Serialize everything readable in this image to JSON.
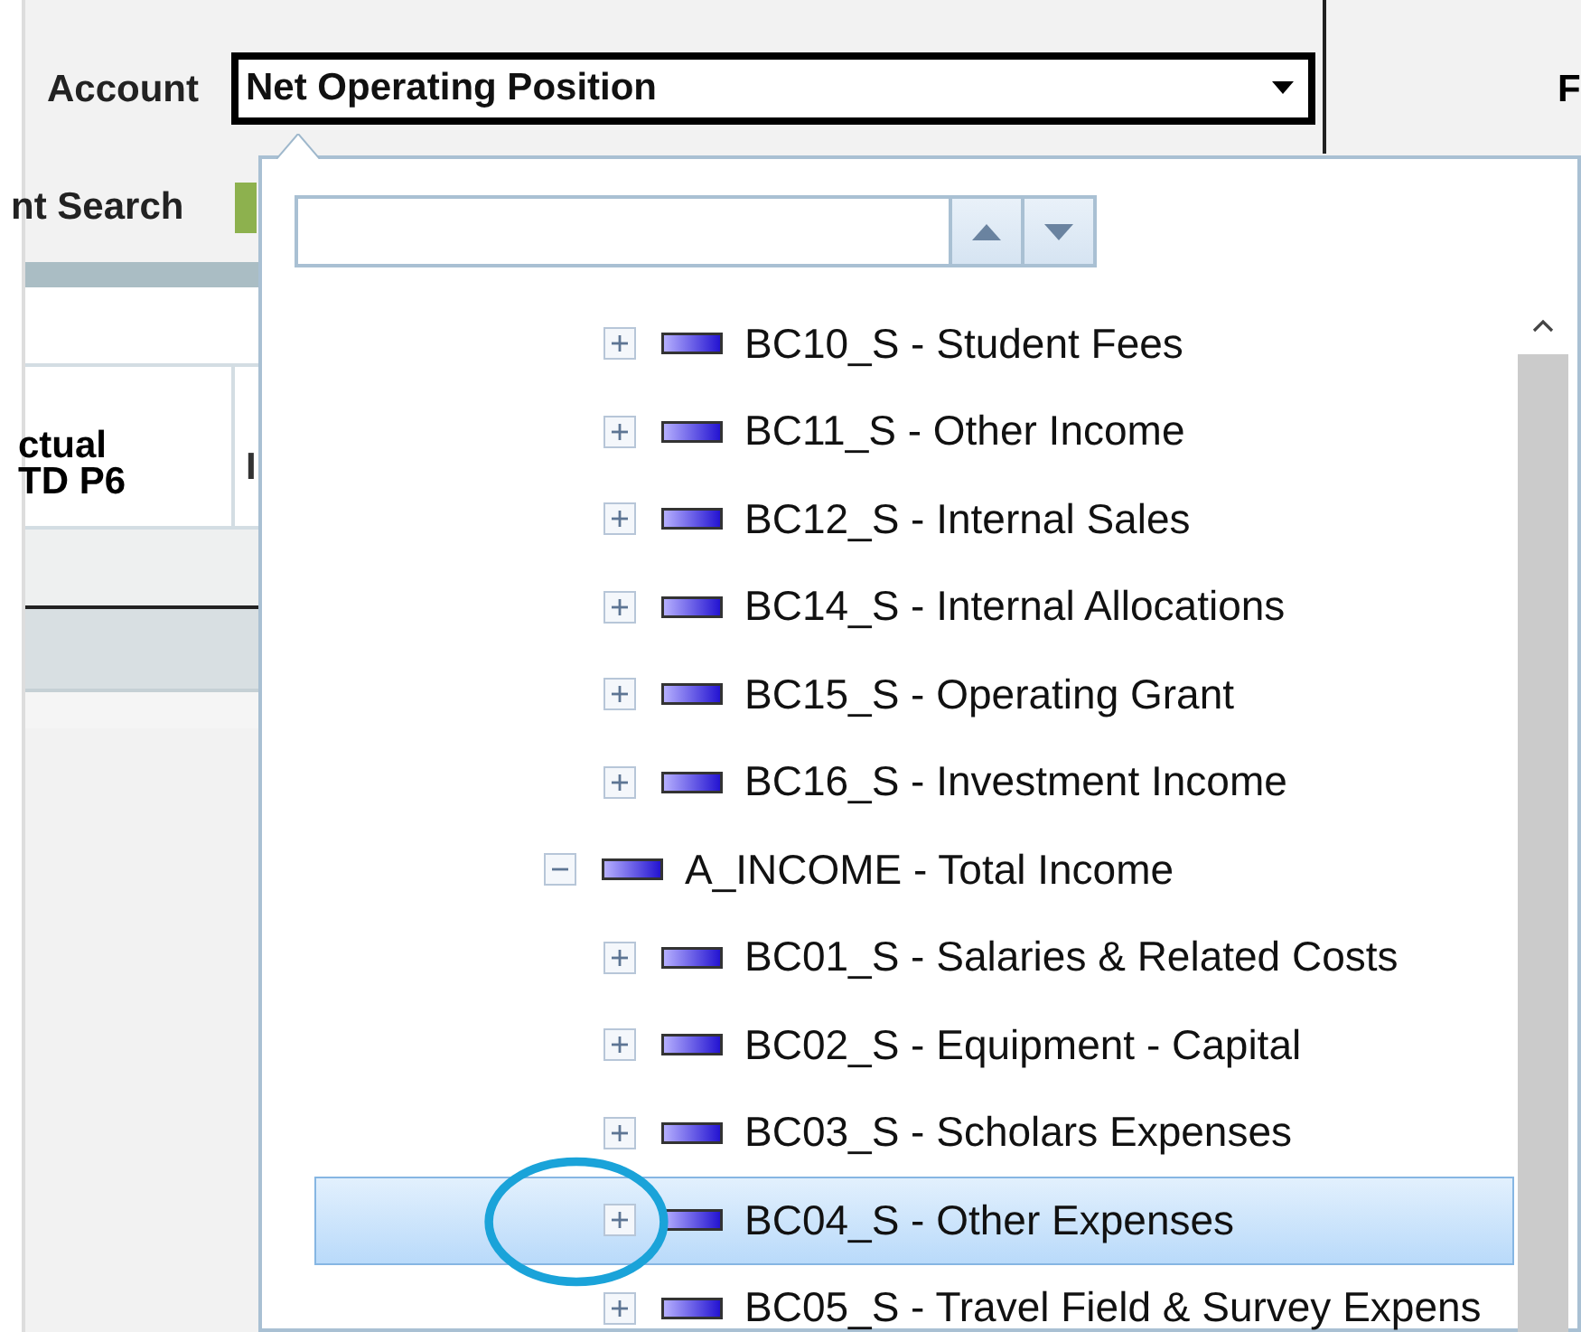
{
  "toolbar": {
    "account_label": "Account",
    "account_value": "Net Operating Position",
    "right_label": "F",
    "search_label": "nt Search"
  },
  "table": {
    "columns": [
      "ctual\nTD P6",
      "I"
    ]
  },
  "popup": {
    "tree": [
      {
        "children": [
          {
            "label": "BC10_S - Student Fees",
            "expanded": false,
            "selected": false,
            "circled": false
          },
          {
            "label": "BC11_S - Other Income",
            "expanded": false,
            "selected": false,
            "circled": false
          },
          {
            "label": "BC12_S - Internal Sales",
            "expanded": false,
            "selected": false,
            "circled": false
          },
          {
            "label": "BC14_S - Internal Allocations",
            "expanded": false,
            "selected": false,
            "circled": false
          },
          {
            "label": "BC15_S - Operating Grant",
            "expanded": false,
            "selected": false,
            "circled": false
          },
          {
            "label": "BC16_S - Investment Income",
            "expanded": false,
            "selected": false,
            "circled": false
          }
        ]
      },
      {
        "label": "A_INCOME - Total Income",
        "expanded": true,
        "selected": false,
        "circled": false,
        "children": [
          {
            "label": "BC01_S - Salaries & Related Costs",
            "expanded": false,
            "selected": false,
            "circled": false
          },
          {
            "label": "BC02_S - Equipment - Capital",
            "expanded": false,
            "selected": false,
            "circled": false
          },
          {
            "label": "BC03_S - Scholars Expenses",
            "expanded": false,
            "selected": false,
            "circled": false
          },
          {
            "label": "BC04_S - Other Expenses",
            "expanded": false,
            "selected": true,
            "circled": true
          },
          {
            "label": "BC05_S - Travel Field & Survey Expens",
            "expanded": false,
            "selected": false,
            "circled": false
          }
        ]
      }
    ]
  }
}
